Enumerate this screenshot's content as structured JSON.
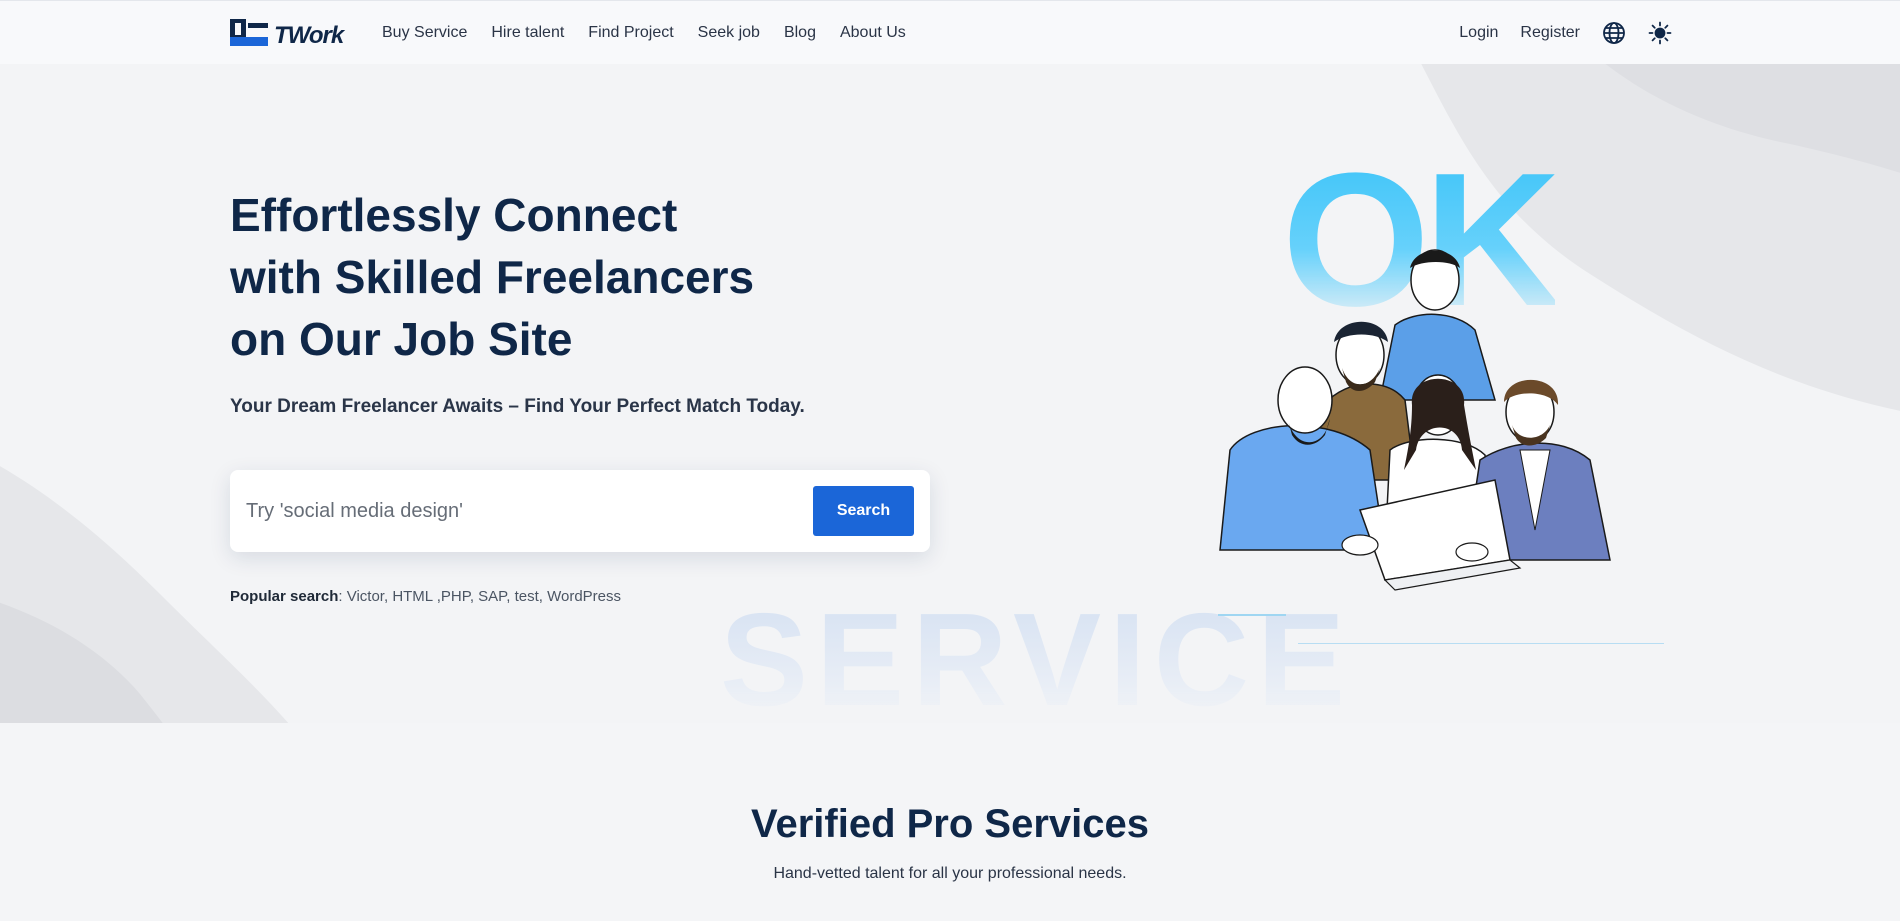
{
  "brand": {
    "logo_text": "TWork",
    "accent": "#1b66d8",
    "text_dark": "#0f2748"
  },
  "nav": {
    "items": [
      {
        "label": "Buy Service"
      },
      {
        "label": "Hire talent"
      },
      {
        "label": "Find Project"
      },
      {
        "label": "Seek job"
      },
      {
        "label": "Blog"
      },
      {
        "label": "About Us"
      }
    ],
    "login": "Login",
    "register": "Register",
    "language_icon": "globe-icon",
    "theme_icon": "sun-icon"
  },
  "hero": {
    "title_lines": [
      "Effortlessly Connect",
      "with Skilled Freelancers",
      "on Our Job Site"
    ],
    "subtitle": "Your Dream Freelancer Awaits – Find Your Perfect Match Today.",
    "search": {
      "placeholder": "Try 'social media design'",
      "value": "",
      "button_label": "Search"
    },
    "popular": {
      "label": "Popular search",
      "terms": "Victor, HTML ,PHP, SAP, test, WordPress"
    },
    "bg_word": "SERVICE",
    "illustration_word": "OK"
  },
  "section": {
    "title": "Verified Pro Services",
    "subtitle": "Hand-vetted talent for all your professional needs."
  }
}
